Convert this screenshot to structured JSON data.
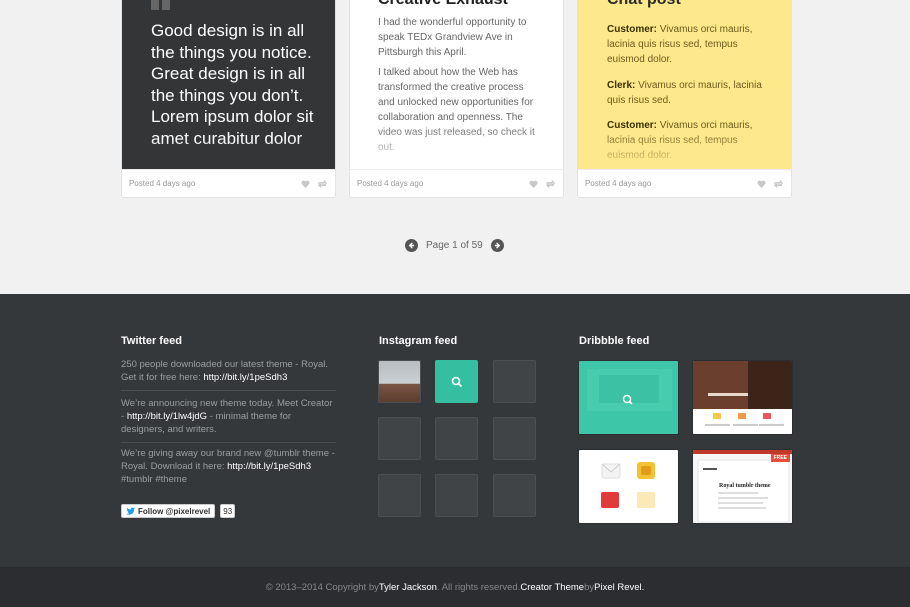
{
  "cards": {
    "quote": {
      "text": "Good design is in all the things you notice. Great design is in all the things you don’t. Lorem ipsum dolor sit amet curabitur dolor",
      "posted": "Posted 4 days ago"
    },
    "text_post": {
      "title": "Creative Exhaust",
      "para1": "I had the wonderful opportunity to speak TEDx Grandview Ave in Pittsburgh this April.",
      "para2": "I talked about how the Web has transformed the creative process and unlocked new opportunities for collaboration and openness. The video was just released, so check it out.",
      "posted": "Posted 4 days ago"
    },
    "chat": {
      "title": "Chat post",
      "lines": [
        {
          "speaker": "Customer:",
          "text": " Vivamus orci mauris, lacinia quis risus sed, tempus euismod dolor."
        },
        {
          "speaker": "Clerk:",
          "text": " Vivamus orci mauris, lacinia quis risus sed."
        },
        {
          "speaker": "Customer:",
          "text": " Vivamus orci mauris, lacinia quis risus sed, tempus euismod dolor."
        }
      ],
      "posted": "Posted 4 days ago"
    }
  },
  "pagination": {
    "label": "Page 1 of 59"
  },
  "footer": {
    "twitter": {
      "title": "Twitter feed",
      "tweets": [
        {
          "text": "250 people downloaded our latest theme - Royal. Get it for free here: ",
          "link": "http://bit.ly/1peSdh3",
          "tail": ""
        },
        {
          "text": "We’re announcing new theme today. Meet Creator - ",
          "link": "http://bit.ly/1lw4jdG",
          "tail": "  - minimal theme for designers, and writers."
        },
        {
          "text": "We’re giving away our brand new @tumblr theme - Royal. Download it here: ",
          "link": "http://bit.ly/1peSdh3",
          "tail": " #tumblr #theme"
        }
      ],
      "follow_label": "Follow @pixelrevel",
      "follow_count": "93"
    },
    "instagram": {
      "title": "Instagram feed"
    },
    "dribbble": {
      "title": "Dribbble feed",
      "badge": "FREE",
      "shot_title": "Royal tumblr theme"
    }
  },
  "copyright": {
    "prefix": "© 2013–2014 Copyright by ",
    "author": "Tyler Jackson",
    "middle": ". All rights reserved. ",
    "theme": "Creator Theme",
    "by": " by ",
    "company": "Pixel Revel."
  },
  "colors": {
    "accent_teal": "#33bfa0",
    "chat_yellow": "#fde88b",
    "footer_bg": "#35383b"
  }
}
